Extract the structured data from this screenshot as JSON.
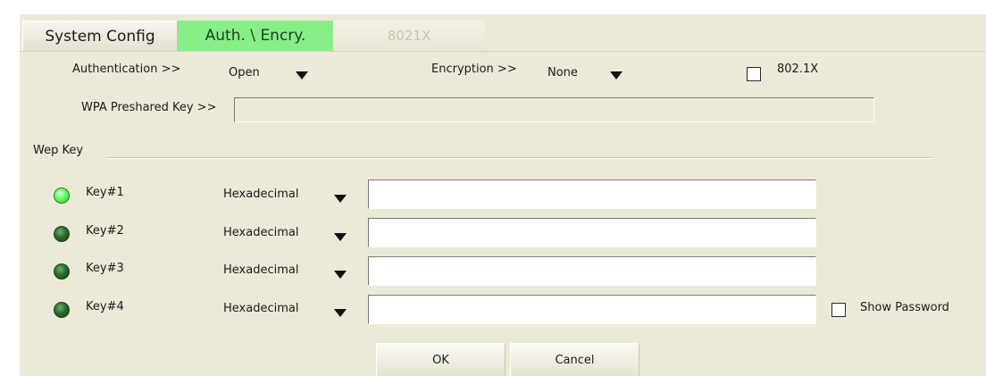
{
  "tabs": [
    {
      "label": "System Config",
      "state": "normal"
    },
    {
      "label": "Auth. \\ Encry.",
      "state": "selected"
    },
    {
      "label": "8021X",
      "state": "disabled"
    }
  ],
  "auth": {
    "label": "Authentication >>",
    "value": "Open"
  },
  "encryption": {
    "label": "Encryption >>",
    "value": "None"
  },
  "dot1x": {
    "label": "802.1X",
    "checked": false
  },
  "wpa": {
    "label": "WPA Preshared Key >>",
    "value": ""
  },
  "wep": {
    "group_label": "Wep Key",
    "keys": [
      {
        "label": "Key#1",
        "format": "Hexadecimal",
        "value": "",
        "active": true
      },
      {
        "label": "Key#2",
        "format": "Hexadecimal",
        "value": "",
        "active": false
      },
      {
        "label": "Key#3",
        "format": "Hexadecimal",
        "value": "",
        "active": false
      },
      {
        "label": "Key#4",
        "format": "Hexadecimal",
        "value": "",
        "active": false
      }
    ]
  },
  "show_password": {
    "label": "Show Password",
    "checked": false
  },
  "buttons": {
    "ok": "OK",
    "cancel": "Cancel"
  },
  "colors": {
    "panel_bg": "#ece9d8",
    "selected_tab": "#88ee88",
    "led_active": "#66ff66",
    "led_inactive": "#2c6a2c"
  }
}
